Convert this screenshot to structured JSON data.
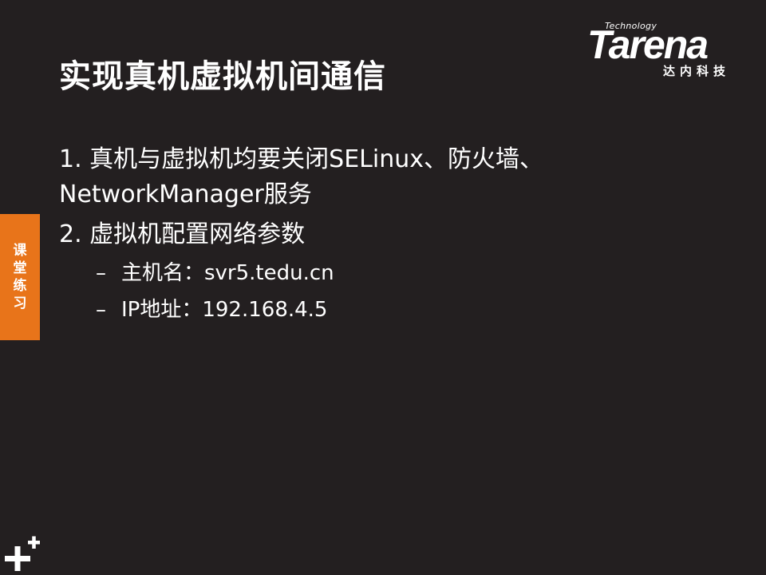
{
  "slide": {
    "title": "实现真机虚拟机间通信",
    "logo": {
      "small_text": "Technology",
      "wordmark": "Tarena",
      "chinese": "达内科技"
    },
    "side_tab": [
      "课",
      "堂",
      "练",
      "习"
    ],
    "items": [
      {
        "line1": "1. 真机与虚拟机均要关闭SELinux、防火墙、",
        "line2": "NetworkManager服务"
      },
      {
        "line1": "2. 虚拟机配置网络参数"
      }
    ],
    "subitems": [
      {
        "dash": "–",
        "text": "主机名：svr5.tedu.cn"
      },
      {
        "dash": "–",
        "text": "IP地址：192.168.4.5"
      }
    ],
    "colors": {
      "background": "#231f20",
      "accent": "#e8741a",
      "text": "#ffffff"
    },
    "icons": [
      "plus-mark-icon"
    ]
  }
}
